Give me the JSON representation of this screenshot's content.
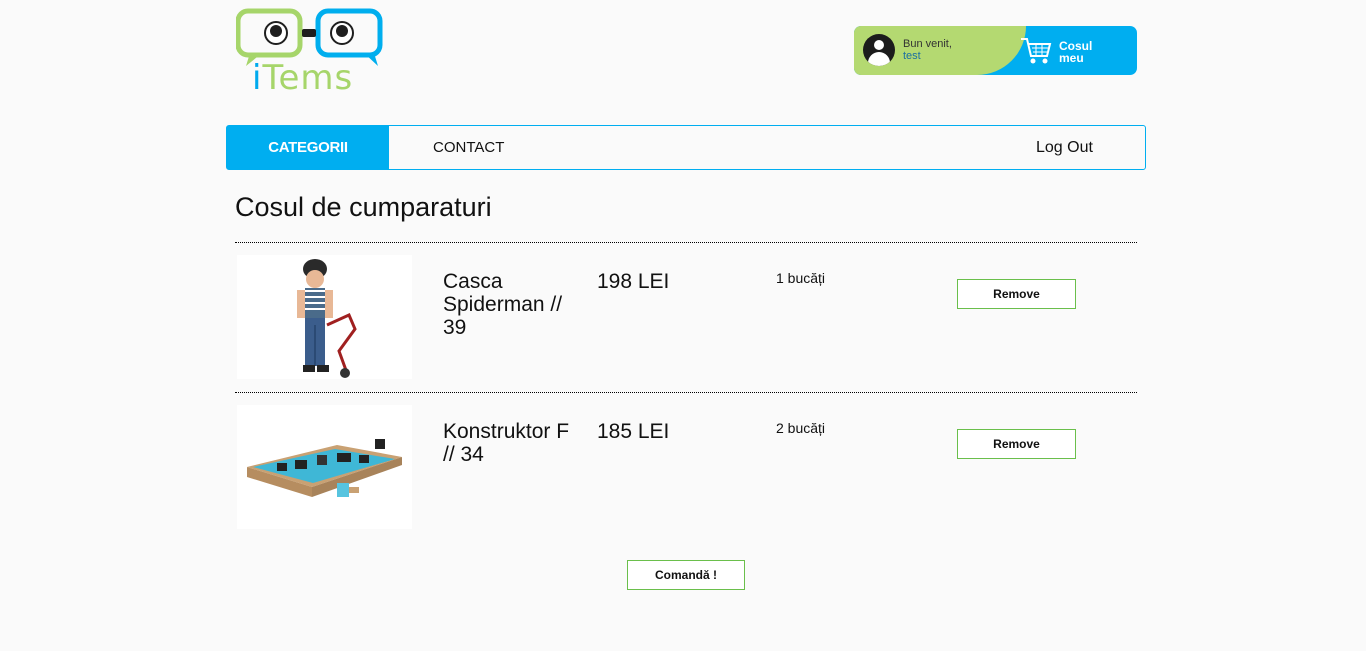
{
  "header": {
    "logo_text_prefix": "i",
    "logo_text_rest": "Tems",
    "welcome_label": "Bun venit,",
    "username": "test",
    "cart_label_line1": "Cosul",
    "cart_label_line2": "meu"
  },
  "nav": {
    "items": [
      {
        "label": "CATEGORII",
        "active": true
      },
      {
        "label": "CONTACT",
        "active": false
      },
      {
        "label": "Log Out",
        "active": false
      }
    ]
  },
  "page": {
    "title": "Cosul de cumparaturi"
  },
  "cart": {
    "items": [
      {
        "name": "Casca Spiderman // 39",
        "price": "198 LEI",
        "quantity": "1 bucăți",
        "remove_label": "Remove",
        "image": "kid-with-scooter-photo"
      },
      {
        "name": "Konstruktor F // 34",
        "price": "185 LEI",
        "quantity": "2 bucăți",
        "remove_label": "Remove",
        "image": "construction-kit-photo"
      }
    ],
    "order_label": "Comandă !"
  },
  "colors": {
    "accent_blue": "#00aef0",
    "accent_green": "#b4d971",
    "button_border": "#6abf4b"
  }
}
